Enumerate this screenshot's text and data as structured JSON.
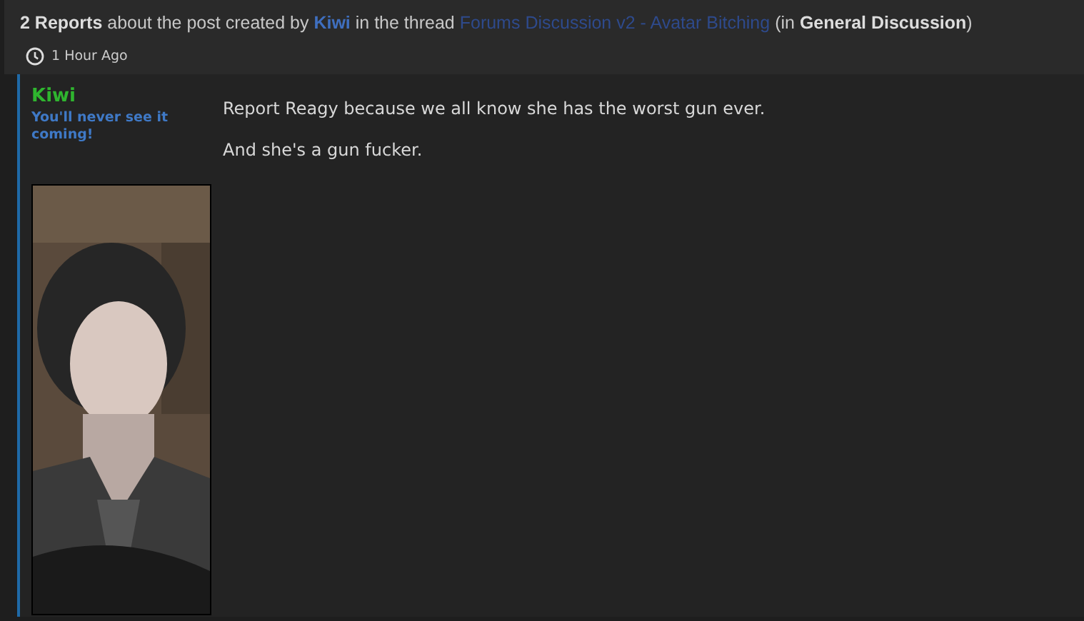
{
  "report_header": {
    "segments": [
      {
        "kind": "text",
        "text": "**2 Reports** about the post created by"
      },
      {
        "kind": "user_link",
        "text": "Kiwi"
      },
      {
        "kind": "text",
        "text": "in the thread"
      },
      {
        "kind": "thread_link",
        "text": "Forums Discussion v2 - Avatar Bitching"
      },
      {
        "kind": "text",
        "text": "(in **General Discussion**)"
      }
    ],
    "time": "1 Hour Ago"
  },
  "post": {
    "author": "Kiwi",
    "user_title": "You'll never see it coming!",
    "paragraphs": [
      "Report Reagy because we all know she has the worst gun ever.",
      "And she's a gun fucker."
    ]
  }
}
